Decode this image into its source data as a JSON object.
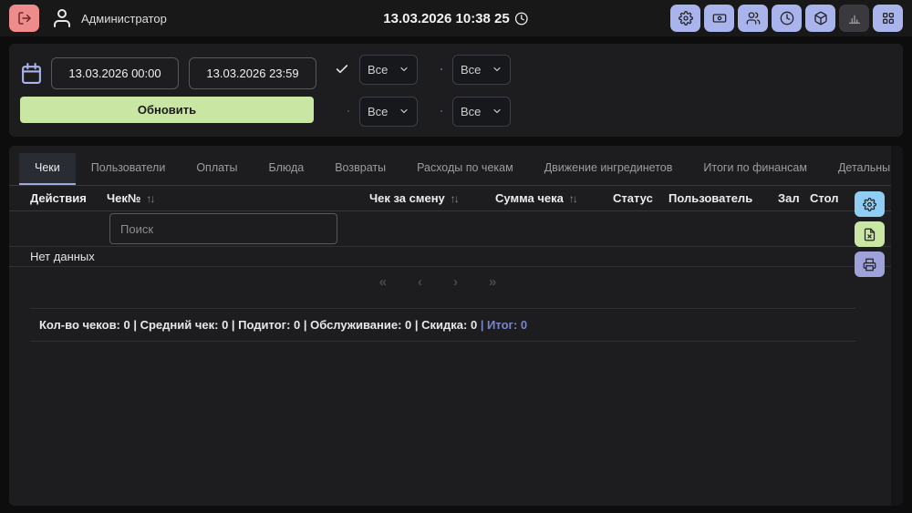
{
  "topbar": {
    "user": "Администратор",
    "datetime": "13.03.2026 10:38 25",
    "icons": [
      "logout-icon",
      "user-icon",
      "clock-icon"
    ],
    "actions": [
      {
        "icon": "gear-icon",
        "active": false
      },
      {
        "icon": "banknote-icon",
        "active": false
      },
      {
        "icon": "staff-icon",
        "active": false
      },
      {
        "icon": "clock-icon",
        "active": false
      },
      {
        "icon": "box-icon",
        "active": false
      },
      {
        "icon": "bar-chart-icon",
        "active": true
      },
      {
        "icon": "apps-grid-icon",
        "active": false
      }
    ]
  },
  "filters": {
    "calendar_icon": "calendar-icon",
    "date_from": "13.03.2026 00:00",
    "date_to": "13.03.2026 23:59",
    "refresh_label": "Обновить",
    "dropdowns": [
      {
        "icon": "check-icon",
        "value": "Все"
      },
      {
        "icon": "grid-icon",
        "value": "Все"
      },
      {
        "icon": "user-arrow-icon",
        "value": "Все"
      },
      {
        "icon": "banknote-icon",
        "value": "Все"
      }
    ]
  },
  "tabs": [
    {
      "label": "Чеки",
      "active": true
    },
    {
      "label": "Пользователи",
      "active": false
    },
    {
      "label": "Оплаты",
      "active": false
    },
    {
      "label": "Блюда",
      "active": false
    },
    {
      "label": "Возвраты",
      "active": false
    },
    {
      "label": "Расходы по чекам",
      "active": false
    },
    {
      "label": "Движение ингрединетов",
      "active": false
    },
    {
      "label": "Итоги по финансам",
      "active": false
    },
    {
      "label": "Детальный финансовый отчёт",
      "active": false
    }
  ],
  "table": {
    "columns": [
      {
        "label": "Действия",
        "sortable": false
      },
      {
        "label": "Чек№",
        "sortable": true
      },
      {
        "label": "Чек за смену",
        "sortable": true
      },
      {
        "label": "Сумма чека",
        "sortable": true
      },
      {
        "label": "Статус",
        "sortable": false
      },
      {
        "label": "Пользователь",
        "sortable": false
      },
      {
        "label": "Зал",
        "sortable": false
      },
      {
        "label": "Стол",
        "sortable": false
      }
    ],
    "sort_glyph": "↑↓",
    "search_placeholder": "Поиск",
    "empty_text": "Нет данных",
    "pagination": {
      "first": "«",
      "prev": "‹",
      "next": "›",
      "last": "»"
    },
    "side_buttons": [
      {
        "icon": "gear-icon",
        "color": "#90cdf4"
      },
      {
        "icon": "file-excel-icon",
        "color": "#c9e6a3"
      },
      {
        "icon": "printer-icon",
        "color": "#9fa1da"
      }
    ]
  },
  "summary": {
    "main": "Кол-во чеков: 0 | Средний чек: 0 | Подитог: 0 | Обслуживание: 0 | Скидка: 0 ",
    "total": "| Итог: 0"
  },
  "colors": {
    "page_bg": "#0d0d0d",
    "topbar_bg": "#181818",
    "panel_bg": "#1d1d1f",
    "accent_periwinkle": "#aab4ec",
    "logout_red": "#ee8c8c",
    "refresh_green": "#c9e6a3",
    "settings_blue": "#90cdf4",
    "print_purple": "#9fa1da",
    "tab_underline": "#9fa8da",
    "total_blue": "#7986cb"
  }
}
